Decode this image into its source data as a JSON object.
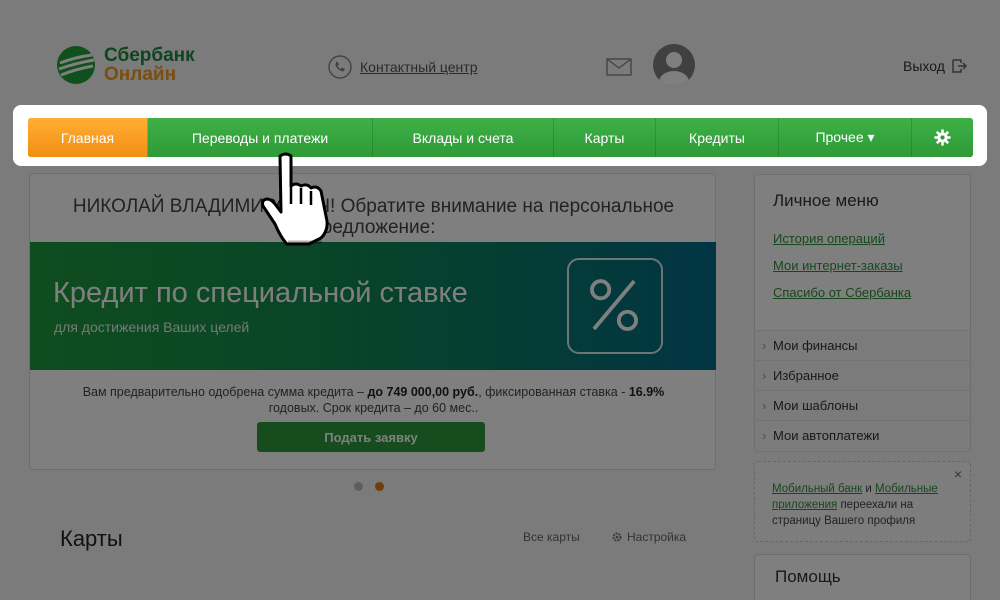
{
  "logo": {
    "line1": "Сбербанк",
    "line2": "Онлайн"
  },
  "header": {
    "contact_center": "Контактный центр",
    "logout": "Выход"
  },
  "nav": {
    "items": [
      {
        "label": "Главная"
      },
      {
        "label": "Переводы и платежи"
      },
      {
        "label": "Вклады и счета"
      },
      {
        "label": "Карты"
      },
      {
        "label": "Кредиты"
      },
      {
        "label": "Прочее ▾"
      }
    ]
  },
  "offer": {
    "greeting": "НИКОЛАЙ ВЛАДИМИРОВИЧ! Обратите внимание на персональное предложение:",
    "banner_title": "Кредит по специальной ставке",
    "banner_subtitle": "для достижения Ваших целей",
    "text_part1": "Вам предварительно одобрена сумма кредита – ",
    "text_amount": "до 749 000,00 руб.",
    "text_part2": ", фиксированная ставка - ",
    "text_rate": "16.9%",
    "text_part3": " годовых. Срок кредита – до 60 мес..",
    "apply_button": "Подать заявку"
  },
  "cards": {
    "title": "Карты",
    "all_cards": "Все карты",
    "settings": "Настройка"
  },
  "sidebar": {
    "title": "Личное меню",
    "links": [
      {
        "label": "История операций"
      },
      {
        "label": "Мои интернет-заказы"
      },
      {
        "label": "Спасибо от Сбербанка"
      }
    ],
    "sections": [
      {
        "label": "Мои финансы"
      },
      {
        "label": "Избранное"
      },
      {
        "label": "Мои шаблоны"
      },
      {
        "label": "Мои автоплатежи"
      }
    ]
  },
  "notice": {
    "link1": "Мобильный банк",
    "and": " и ",
    "link2": "Мобильные приложения",
    "rest": " переехали на страницу Вашего профиля",
    "close": "×"
  },
  "help": {
    "title": "Помощь"
  },
  "colors": {
    "brand_green": "#35a63d",
    "active_orange": "#f59a22",
    "link_green": "#2f8f3a"
  }
}
